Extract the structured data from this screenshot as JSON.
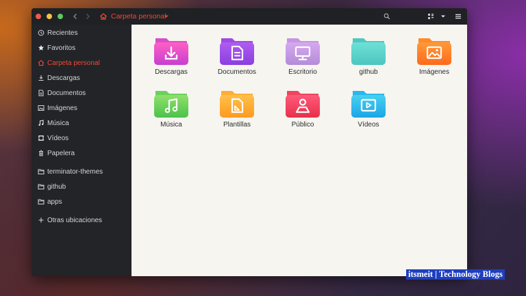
{
  "window": {
    "path_label": "Carpeta personal"
  },
  "sidebar": {
    "items": [
      {
        "label": "Recientes",
        "icon": "clock-icon"
      },
      {
        "label": "Favoritos",
        "icon": "star-icon"
      },
      {
        "label": "Carpeta personal",
        "icon": "home-icon",
        "active": true
      },
      {
        "label": "Descargas",
        "icon": "download-icon"
      },
      {
        "label": "Documentos",
        "icon": "document-icon"
      },
      {
        "label": "Imágenes",
        "icon": "image-icon"
      },
      {
        "label": "Música",
        "icon": "music-icon"
      },
      {
        "label": "Vídeos",
        "icon": "video-icon"
      },
      {
        "label": "Papelera",
        "icon": "trash-icon"
      },
      {
        "label": "terminator-themes",
        "icon": "folder-icon"
      },
      {
        "label": "github",
        "icon": "folder-icon"
      },
      {
        "label": "apps",
        "icon": "folder-icon"
      },
      {
        "label": "Otras ubicaciones",
        "icon": "plus-icon"
      }
    ]
  },
  "folders": [
    {
      "label": "Descargas",
      "icon": "download-icon",
      "color_top": "#ff5fc4",
      "color_bottom": "#c63fd0"
    },
    {
      "label": "Documentos",
      "icon": "document-icon",
      "color_top": "#b05cf0",
      "color_bottom": "#8a3fe0"
    },
    {
      "label": "Escritorio",
      "icon": "monitor-icon",
      "color_top": "#d6a8f0",
      "color_bottom": "#b58cd8"
    },
    {
      "label": "github",
      "icon": "folder-icon",
      "color_top": "#6fe0d6",
      "color_bottom": "#4cc6c0"
    },
    {
      "label": "Imágenes",
      "icon": "image-icon",
      "color_top": "#ff9a3a",
      "color_bottom": "#ff6a1a"
    },
    {
      "label": "Música",
      "icon": "music-icon",
      "color_top": "#8fe06a",
      "color_bottom": "#4cc24a"
    },
    {
      "label": "Plantillas",
      "icon": "template-icon",
      "color_top": "#ffc04a",
      "color_bottom": "#ff9a20"
    },
    {
      "label": "Público",
      "icon": "person-icon",
      "color_top": "#ff5a7a",
      "color_bottom": "#e8304a"
    },
    {
      "label": "Vídeos",
      "icon": "video-icon",
      "color_top": "#4ad0f0",
      "color_bottom": "#1aa6e6"
    }
  ],
  "watermark": {
    "text": "itsmeit | Technology Blogs"
  },
  "colors": {
    "accent": "#ef4a37",
    "sidebar_bg": "#222427",
    "content_bg": "#f6f5f0"
  }
}
